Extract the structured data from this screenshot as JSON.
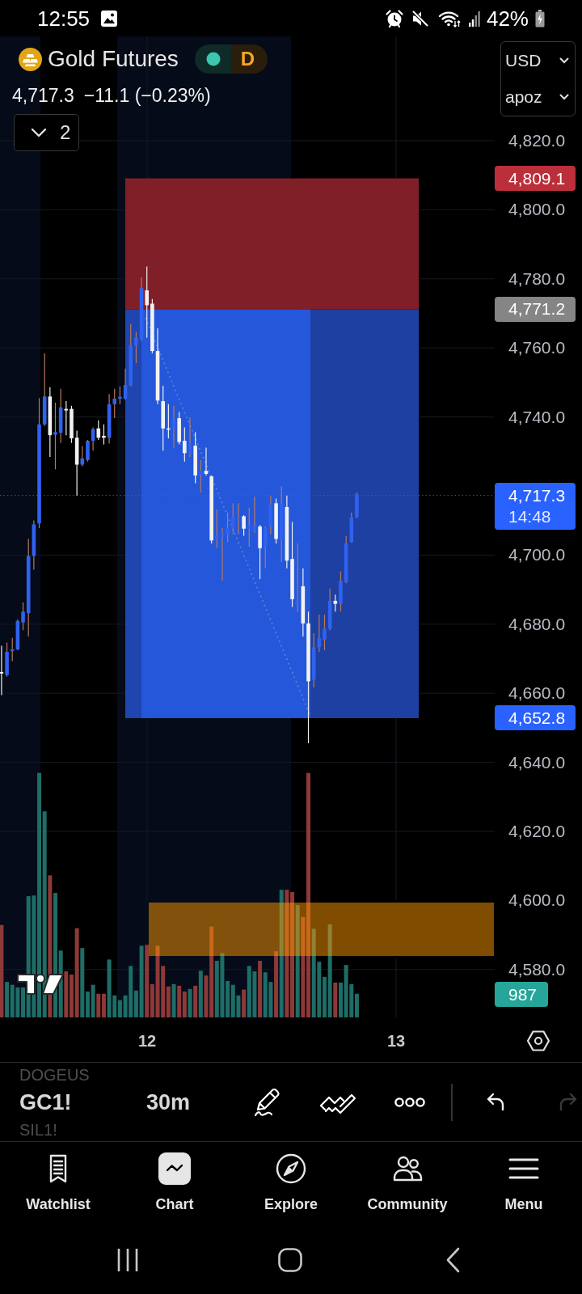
{
  "status_bar": {
    "time": "12:55",
    "battery": "42%"
  },
  "symbol": {
    "name": "Gold Futures",
    "market_open": true,
    "data_badge": "D",
    "last_price": "4,717.3",
    "change": "−11.1 (−0.23%)"
  },
  "indicators_button": {
    "count": "2",
    "expanded": false
  },
  "unit_selector": {
    "currency": "USD",
    "unit": "apoz"
  },
  "price_axis": {
    "ticks": [
      "4,820.0",
      "4,800.0",
      "4,780.0",
      "4,760.0",
      "4,740.0",
      "4,700.0",
      "4,680.0",
      "4,660.0",
      "4,640.0",
      "4,620.0",
      "4,600.0",
      "4,580.0"
    ]
  },
  "price_labels": [
    {
      "kind": "stop",
      "text": "4,809.1",
      "color": "#bb2f3a"
    },
    {
      "kind": "entry",
      "text": "4,771.2",
      "color": "#858585"
    },
    {
      "kind": "last",
      "text": "4,717.3",
      "countdown": "14:48",
      "color": "#2962ff"
    },
    {
      "kind": "target",
      "text": "4,652.8",
      "color": "#2962ff"
    }
  ],
  "volume_label": "987",
  "time_axis": {
    "labels": [
      "12",
      "13"
    ]
  },
  "toolbar": {
    "symbols": [
      {
        "label": "DOGEUS",
        "selected": false
      },
      {
        "label": "GC1!",
        "selected": true
      },
      {
        "label": "SIL1!",
        "selected": false
      }
    ],
    "interval": "30m",
    "history": [
      {
        "kind": "undo",
        "disabled": false
      },
      {
        "kind": "redo",
        "disabled": true
      }
    ]
  },
  "bottom_nav": [
    {
      "label": "Watchlist",
      "selected": false
    },
    {
      "label": "Chart",
      "selected": true
    },
    {
      "label": "Explore",
      "selected": false
    },
    {
      "label": "Community",
      "selected": false
    },
    {
      "label": "Menu",
      "selected": false
    }
  ]
}
